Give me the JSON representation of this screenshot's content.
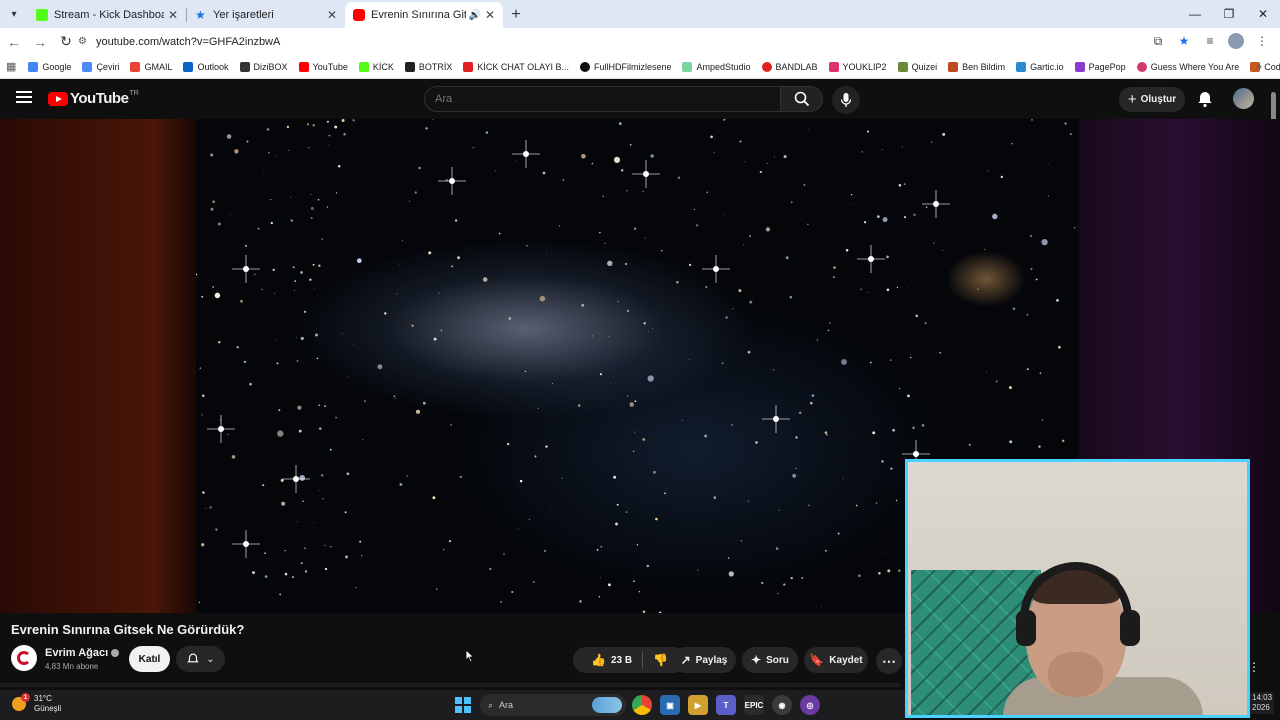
{
  "browser": {
    "tabs": [
      {
        "title": "Stream - Kick Dashboard",
        "color": "#53fc18"
      },
      {
        "title": "Yer işaretleri",
        "color": "#1a73e8"
      },
      {
        "title": "Evrenin Sınırına Gitsek Ne Gö",
        "color": "#ff0000"
      }
    ],
    "url": "youtube.com/watch?v=GHFA2inzbwA",
    "bookmarks": [
      "Google",
      "Çeviri",
      "GMAIL",
      "Outlook",
      "DiziBOX",
      "YouTube",
      "KİCK",
      "BOTRİX",
      "KİCK CHAT OLAYI B...",
      "FullHDFilmizlesene",
      "AmpedStudio",
      "BANDLAB",
      "YOUKLIP2",
      "Quizei",
      "Ben Bildim",
      "Gartic.io",
      "PagePop",
      "Guess Where You Are",
      "Codenames"
    ]
  },
  "youtube": {
    "logo_text": "YouTube",
    "country": "TR",
    "search_placeholder": "Ara",
    "create_label": "Oluştur"
  },
  "video": {
    "title": "Evrenin Sınırına Gitsek Ne Görürdük?",
    "channel_name": "Evrim Ağacı",
    "subscribers": "4,83 Mn abone",
    "join_label": "Katıl",
    "likes": "23 B",
    "share_label": "Paylaş",
    "ask_label": "Soru",
    "save_label": "Kaydet"
  },
  "taskbar": {
    "temperature": "31°C",
    "weather": "Güneşli",
    "weather_badge": "1",
    "search_label": "Ara",
    "time": "14:03",
    "year": "2026"
  },
  "colors": {
    "accent_red": "#ff0000",
    "webcam_border": "#49d1ff",
    "background": "#0f0f0f"
  }
}
